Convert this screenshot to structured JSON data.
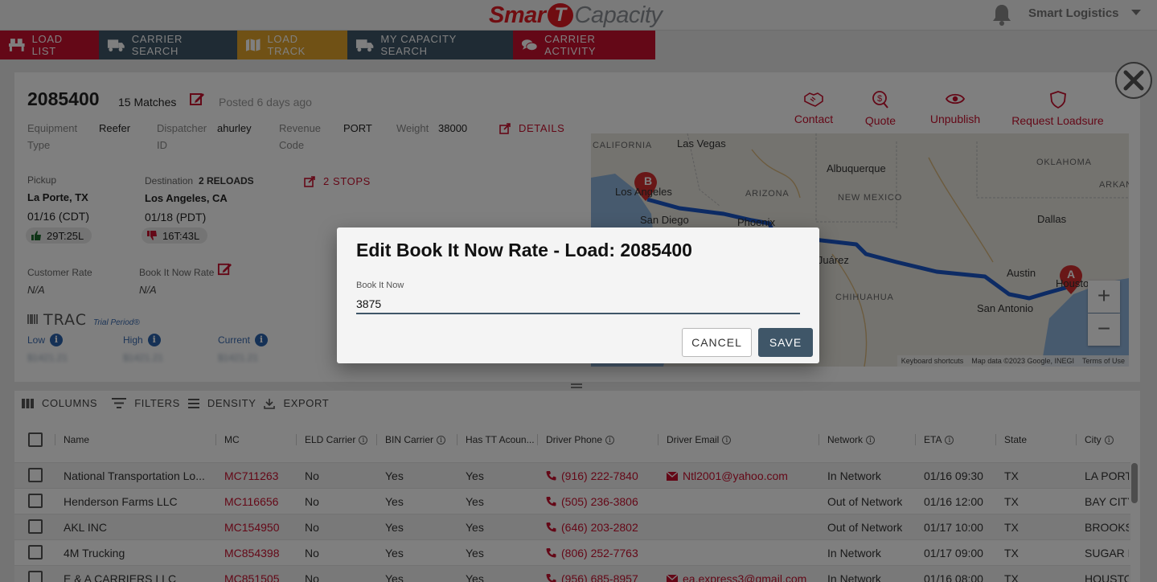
{
  "header": {
    "logo_smart": "Smar",
    "logo_t": "T",
    "logo_capacity": "Capacity",
    "account_name": "Smart Logistics"
  },
  "nav": {
    "tabs": [
      {
        "label": "LOAD LIST",
        "icon": "load-list-icon",
        "color": "#c8102e"
      },
      {
        "label": "CARRIER SEARCH",
        "icon": "truck-icon",
        "color": "#3f5668"
      },
      {
        "label": "LOAD TRACK",
        "icon": "map-icon",
        "color": "#e1a32b"
      },
      {
        "label": "MY CAPACITY SEARCH",
        "icon": "truck-icon",
        "color": "#3f5668"
      },
      {
        "label": "CARRIER ACTIVITY",
        "icon": "chat-icon",
        "color": "#c8102e"
      }
    ]
  },
  "load": {
    "id": "2085400",
    "matches": "15 Matches",
    "posted": "Posted 6 days ago",
    "equipment_type_label": "Equipment Type",
    "equipment_type": "Reefer",
    "dispatcher_label": "Dispatcher ID",
    "dispatcher": "ahurley",
    "revenue_label": "Revenue Code",
    "revenue": "PORT",
    "weight_label": "Weight",
    "weight": "38000",
    "details_link": "DETAILS",
    "pickup_label": "Pickup",
    "pickup_city": "La Porte, TX",
    "pickup_date": "01/16  (CDT)",
    "pickup_chip": "29T:25L",
    "destination_label": "Destination",
    "reloads": "2 RELOADS",
    "destination_city": "Los Angeles, CA",
    "destination_date": "01/18  (PDT)",
    "destination_chip": "16T:43L",
    "stops_link": "2 STOPS",
    "customer_rate_label": "Customer Rate",
    "customer_rate": "N/A",
    "bin_rate_label": "Book It Now Rate",
    "bin_rate": "N/A",
    "trac_brand": "TRAC",
    "trac_trial": "Trial Period®",
    "low_label": "Low",
    "high_label": "High",
    "current_label": "Current",
    "low_value": "$1421.21",
    "high_value": "$1421.21",
    "current_value": "$1421.21"
  },
  "actions": [
    {
      "label": "Contact",
      "icon": "handshake-icon"
    },
    {
      "label": "Quote",
      "icon": "quote-icon"
    },
    {
      "label": "Unpublish",
      "icon": "eye-icon"
    },
    {
      "label": "Request Loadsure",
      "icon": "shield-icon"
    }
  ],
  "map": {
    "labels": {
      "california": "CALIFORNIA",
      "las_vegas": "Las Vegas",
      "albuquerque": "Albuquerque",
      "oklahoma": "OKLAHOMA",
      "arkansas": "ARKANS",
      "los_angeles": "Los Angeles",
      "arizona": "ARIZONA",
      "new_mexico": "NEW MEXICO",
      "san_diego": "San Diego",
      "phoenix": "Phoenix",
      "dallas": "Dallas",
      "juarez": "d Juárez",
      "austin": "Austin",
      "houston": "Houston",
      "chihuahua": "CHIHUAHUA",
      "san_antonio": "San Antonio"
    },
    "marker_a": "A",
    "marker_b": "B",
    "zoom_in": "+",
    "zoom_out": "−",
    "footer": [
      "Keyboard shortcuts",
      "Map data ©2023 Google, INEGI",
      "Terms of Use"
    ],
    "route_color": "#1a56c8",
    "marker_color": "#d32f2f"
  },
  "grid": {
    "toolbar": [
      "COLUMNS",
      "FILTERS",
      "DENSITY",
      "EXPORT"
    ],
    "columns": [
      "Name",
      "MC",
      "ELD Carrier",
      "BIN Carrier",
      "Has TT Acoun...",
      "Driver Phone",
      "Driver Email",
      "Network",
      "ETA",
      "State",
      "City"
    ],
    "rows": [
      {
        "name": "National Transportation Lo...",
        "mc": "MC711263",
        "eld": "No",
        "bin": "Yes",
        "tt": "Yes",
        "phone": "(916) 222-7840",
        "email": "Ntl2001@yahoo.com",
        "network": "In Network",
        "eta": "01/16 09:30",
        "state": "TX",
        "city": "LA PORT"
      },
      {
        "name": "Henderson Farms LLC",
        "mc": "MC116656",
        "eld": "No",
        "bin": "Yes",
        "tt": "Yes",
        "phone": "(505) 236-3806",
        "email": "",
        "network": "Out of Network",
        "eta": "01/16 12:00",
        "state": "TX",
        "city": "BAY CITY"
      },
      {
        "name": "AKL INC",
        "mc": "MC154950",
        "eld": "No",
        "bin": "Yes",
        "tt": "Yes",
        "phone": "(646) 203-2802",
        "email": "",
        "network": "Out of Network",
        "eta": "01/17 10:00",
        "state": "TX",
        "city": "BROOKS"
      },
      {
        "name": "4M Trucking",
        "mc": "MC854398",
        "eld": "No",
        "bin": "Yes",
        "tt": "Yes",
        "phone": "(806) 252-7763",
        "email": "",
        "network": "In Network",
        "eta": "01/17 09:00",
        "state": "TX",
        "city": "SUGAR L"
      },
      {
        "name": "E & A CARRIERS LLC",
        "mc": "MC851505",
        "eld": "No",
        "bin": "Yes",
        "tt": "Yes",
        "phone": "(956) 685-8957",
        "email": "ea.express3@gmail.com",
        "network": "In Network",
        "eta": "01/16 08:00",
        "state": "TX",
        "city": "HOUSTO"
      }
    ]
  },
  "dialog": {
    "title": "Edit Book It Now Rate - Load: 2085400",
    "field_label": "Book It Now",
    "field_value": "3875",
    "cancel_label": "CANCEL",
    "save_label": "SAVE"
  }
}
